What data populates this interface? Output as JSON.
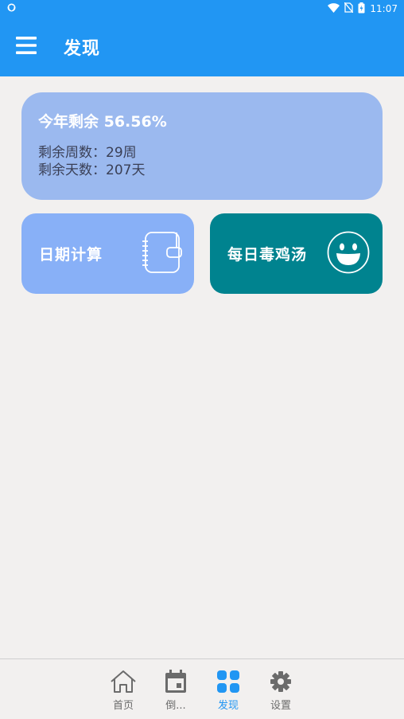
{
  "status_bar": {
    "time": "11:07"
  },
  "app_bar": {
    "title": "发现"
  },
  "year_card": {
    "title": "今年剩余 56.56%",
    "weeks_line": "剩余周数：29周",
    "days_line": "剩余天数：207天"
  },
  "tiles": [
    {
      "label": "日期计算",
      "icon": "notebook-icon",
      "color": "#88b0f7"
    },
    {
      "label": "每日毒鸡汤",
      "icon": "smiley-icon",
      "color": "#00838f"
    }
  ],
  "bottom_nav": {
    "active": "发现",
    "items": [
      {
        "label": "首页",
        "icon": "home-icon"
      },
      {
        "label": "倒...",
        "icon": "calendar-icon"
      },
      {
        "label": "发现",
        "icon": "grid-icon"
      },
      {
        "label": "设置",
        "icon": "gear-icon"
      }
    ]
  },
  "colors": {
    "primary": "#2196f3",
    "card": "#9bb9ef",
    "background": "#f2f0ef"
  }
}
